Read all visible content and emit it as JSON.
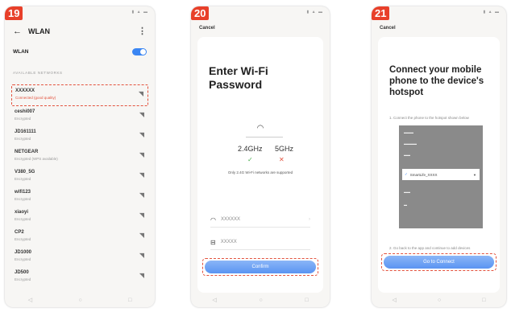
{
  "colors": {
    "accent": "#3b86f3",
    "highlight": "#e3523d",
    "step_badge": "#e8402a"
  },
  "step1": {
    "number": "19",
    "title": "WLAN",
    "wlan_label": "WLAN",
    "section_label": "AVAILABLE NETWORKS",
    "networks": [
      {
        "name": "XXXXXX",
        "status": "Connected (good quality)"
      },
      {
        "name": "ceshi007",
        "status": "Encrypted"
      },
      {
        "name": "JD161111",
        "status": "Encrypted"
      },
      {
        "name": "NETGEAR",
        "status": "Encrypted (WPS available)"
      },
      {
        "name": "V380_5G",
        "status": "Encrypted"
      },
      {
        "name": "wifi123",
        "status": "Encrypted"
      },
      {
        "name": "xiaoyi",
        "status": "Encrypted"
      },
      {
        "name": "CP2",
        "status": "Encrypted"
      },
      {
        "name": "JD1000",
        "status": "Encrypted"
      },
      {
        "name": "JD500",
        "status": "Encrypted"
      }
    ]
  },
  "step2": {
    "number": "20",
    "cancel": "Cancel",
    "heading": "Enter Wi-Fi Password",
    "freq1": "2.4GHz",
    "freq2": "5GHz",
    "note": "Only 2.4G Wi-Fi networks are supported",
    "ssid": "XXXXXX",
    "password": "XXXXX",
    "confirm": "Confirm"
  },
  "step3": {
    "number": "21",
    "cancel": "Cancel",
    "heading": "Connect your mobile phone to the device's hotspot",
    "instruction1": "1. Connect the phone to the hotspot shown below",
    "hotspot_name": "SmartLife_XXXX",
    "instruction2": "2. Go back to the app and continue to add devices",
    "button": "Go to Connect"
  }
}
